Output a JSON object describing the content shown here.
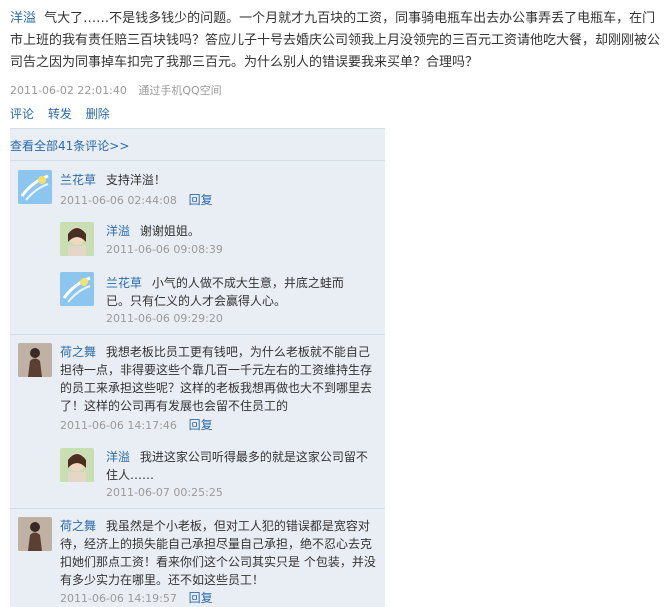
{
  "post": {
    "author": "洋溢",
    "text": "气大了……不是钱多钱少的问题。一个月就才九百块的工资，同事骑电瓶车出去办公事弄丢了电瓶车，在门市上班的我有责任赔三百块钱吗？答应儿子十号去婚庆公司领我上月没领完的三百元工资请他吃大餐，却刚刚被公司告之因为同事掉车扣完了我那三百元。为什么别人的错误要我来买单？合理吗？",
    "time": "2011-06-02 22:01:40",
    "via": "通过手机QQ空间",
    "actions": [
      "评论",
      "转发",
      "删除"
    ]
  },
  "comments_panel": {
    "view_all": "查看全部41条评论>>",
    "comments": [
      {
        "avatar": "orchid-avatar",
        "name": "兰花草",
        "text": "支持洋溢！",
        "time": "2011-06-06 02:44:08",
        "reply_label": "回复",
        "replies": [
          {
            "avatar": "yangyi-avatar",
            "name": "洋溢",
            "text": "谢谢姐姐。",
            "time": "2011-06-06 09:08:39"
          },
          {
            "avatar": "orchid-avatar",
            "name": "兰花草",
            "text": "小气的人做不成大生意，井底之蛙而已。只有仁义的人才会赢得人心。",
            "time": "2011-06-06 09:29:20"
          }
        ]
      },
      {
        "avatar": "hezhiwu-avatar",
        "name": "荷之舞",
        "text": "我想老板比员工更有钱吧，为什么老板就不能自己担待一点，非得要这些个靠几百一千元左右的工资维持生存的员工来承担这些呢？这样的老板我想再做也大不到哪里去了！这样的公司再有发展也会留不住员工的",
        "time": "2011-06-06 14:17:46",
        "reply_label": "回复",
        "replies": [
          {
            "avatar": "yangyi-avatar",
            "name": "洋溢",
            "text": "我进这家公司听得最多的就是这家公司留不住人……",
            "time": "2011-06-07 00:25:25"
          }
        ]
      },
      {
        "avatar": "hezhiwu-avatar",
        "name": "荷之舞",
        "text": "我虽然是个小老板，但对工人犯的错误都是宽容对待，经济上的损失能自己承担尽量自己承担，绝不忍心去克扣她们那点工资！看来你们这个公司其实只是 个包装，并没有多少实力在哪里。还不如这些员工！",
        "time": "2011-06-06 14:19:57",
        "reply_label": "回复"
      }
    ]
  }
}
